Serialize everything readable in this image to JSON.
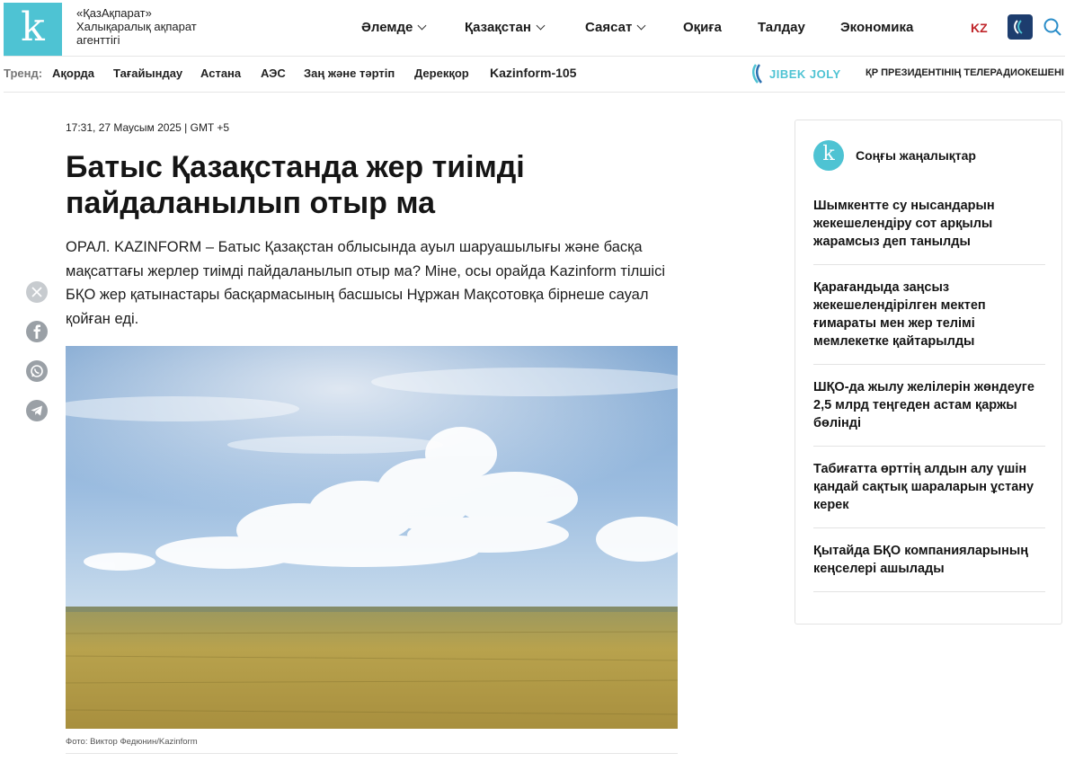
{
  "header": {
    "logo_letter": "k",
    "brand_name": "«ҚазАқпарат»",
    "brand_sub": "Халықаралық ақпарат агенттігі",
    "nav": [
      {
        "label": "Әлемде",
        "has_dropdown": true
      },
      {
        "label": "Қазақстан",
        "has_dropdown": true
      },
      {
        "label": "Саясат",
        "has_dropdown": true
      },
      {
        "label": "Оқиға",
        "has_dropdown": false
      },
      {
        "label": "Талдау",
        "has_dropdown": false
      },
      {
        "label": "Экономика",
        "has_dropdown": false
      }
    ],
    "language": "KZ",
    "partner_icon": "jibek-joly-tv-logo",
    "search_icon": "search-icon"
  },
  "trend": {
    "label": "Тренд:",
    "items": [
      "Ақорда",
      "Тағайындау",
      "Астана",
      "АЭС",
      "Заң және тәртіп",
      "Дерекқор",
      "Kazinform-105"
    ],
    "partner": "JIBEK JOLY",
    "tv_link": "ҚР ПРЕЗИДЕНТІНІҢ ТЕЛЕРАДИОКЕШЕНІ"
  },
  "article": {
    "datetime": "17:31, 27 Маусым 2025 | GMT +5",
    "title": "Батыс Қазақстанда жер тиімді пайдаланылып отыр ма",
    "lead": "ОРАЛ. KAZINFORM – Батыс Қазақстан облысында ауыл шаруашылығы және басқа мақсаттағы жерлер тиімді пайдаланылып отыр ма? Міне, осы орайда Kazinform тілшісі БҚО жер қатынастары басқармасының басшысы Нұржан Мақсотовқа бірнеше сауал қойған еді.",
    "photo_caption": "Фото: Виктор Федюнин/Kazinform",
    "share_icons": [
      "x-icon",
      "facebook-icon",
      "whatsapp-icon",
      "telegram-icon"
    ]
  },
  "sidebar": {
    "title": "Соңғы жаңалықтар",
    "items": [
      "Шымкентте су нысандарын жекешелендіру сот арқылы жарамсыз деп танылды",
      "Қарағандыда заңсыз жекешелендірілген мектеп ғимараты мен жер телімі мемлекетке қайтарылды",
      "ШҚО-да жылу желілерін жөндеуге 2,5 млрд теңгеден астам қаржы бөлінді",
      "Табиғатта өрттің алдын алу үшін қандай сақтық шараларын ұстану керек",
      "Қытайда БҚО компанияларының кеңселері ашылады"
    ]
  },
  "colors": {
    "brand": "#4ec3d3",
    "lang": "#c0262b",
    "share_icon": "#9aa0a6"
  }
}
